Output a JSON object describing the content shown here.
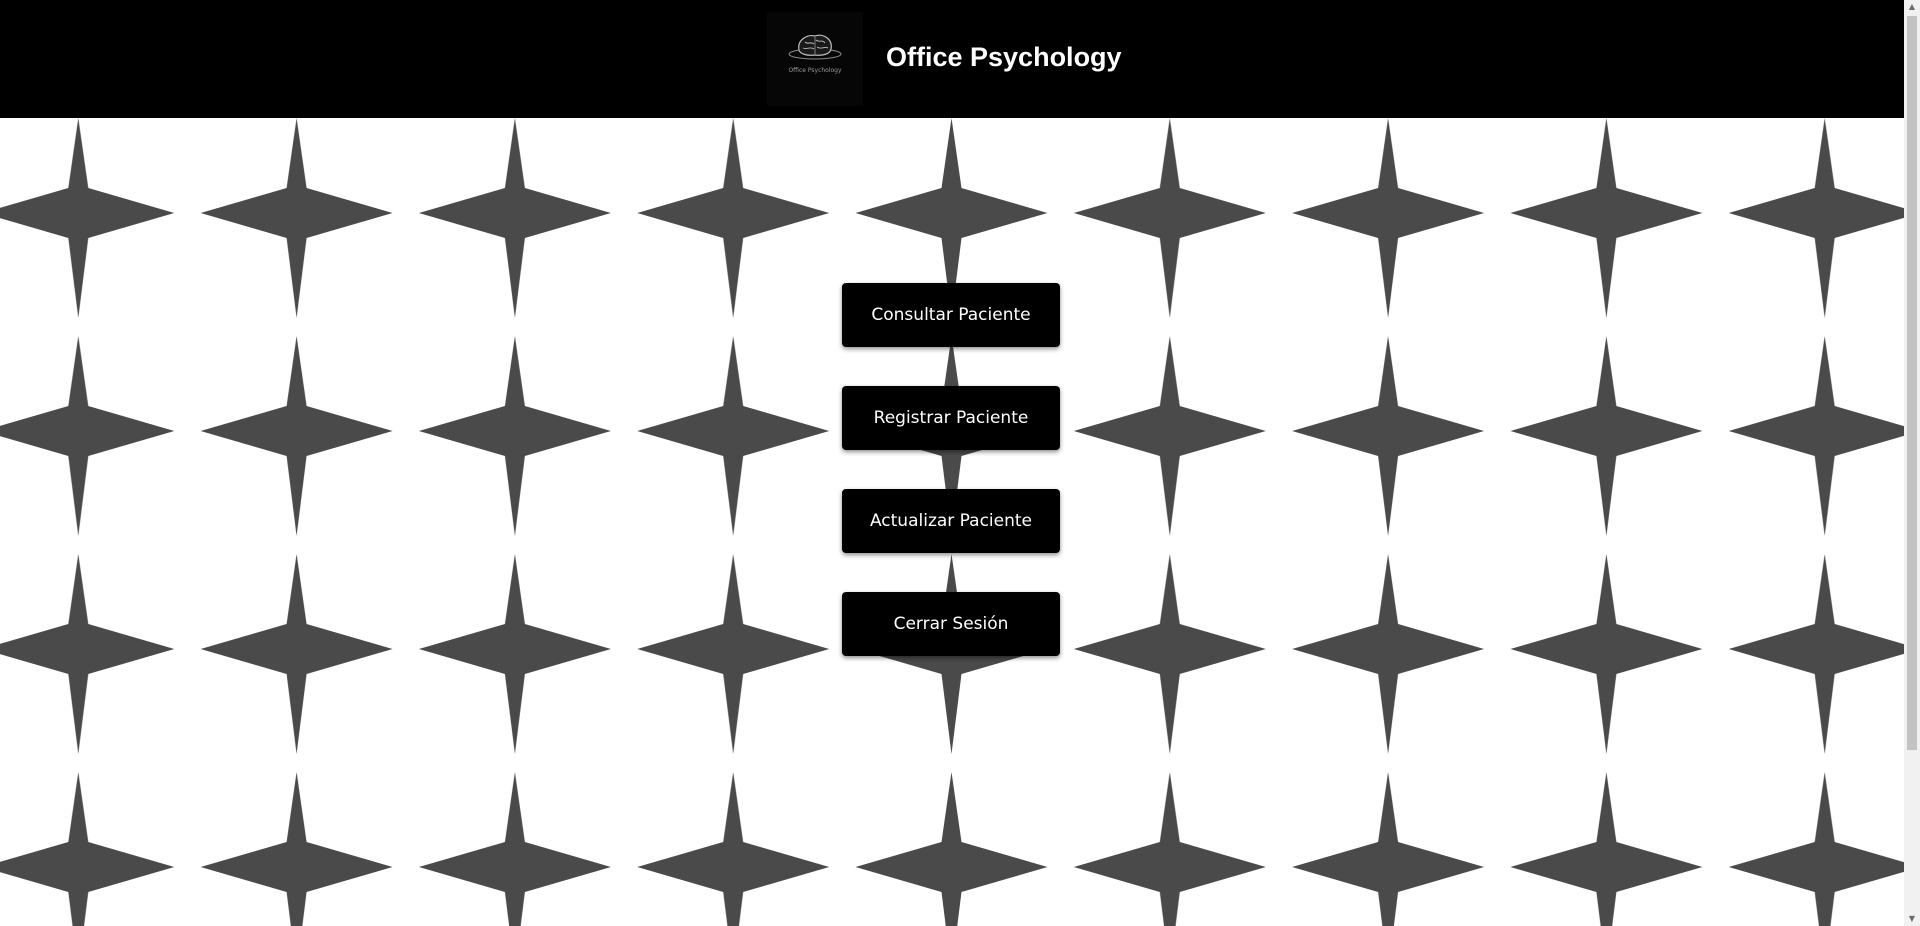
{
  "header": {
    "title": "Office Psychology",
    "logo_text": "Office Psychology",
    "logo_icon": "brain-icon"
  },
  "menu": {
    "buttons": [
      {
        "label": "Consultar Paciente"
      },
      {
        "label": "Registrar Paciente"
      },
      {
        "label": "Actualizar Paciente"
      },
      {
        "label": "Cerrar Sesión"
      }
    ]
  },
  "background": {
    "pattern_icon": "four-point-star-icon",
    "star_color": "#4a4a4a",
    "base_color": "#ffffff"
  },
  "scrollbar": {
    "up_icon": "▲",
    "down_icon": "▼"
  }
}
